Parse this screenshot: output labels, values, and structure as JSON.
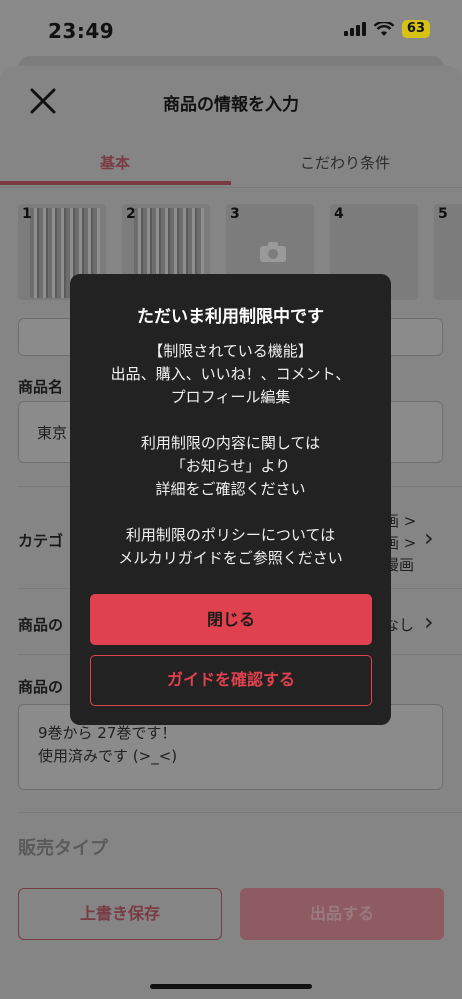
{
  "status_bar": {
    "time": "23:49",
    "battery": "63"
  },
  "header": {
    "title": "商品の情報を入力"
  },
  "tabs": [
    {
      "label": "基本",
      "active": true
    },
    {
      "label": "こだわり条件",
      "active": false
    }
  ],
  "photos": [
    {
      "num": "1",
      "has_image": true
    },
    {
      "num": "2",
      "has_image": true
    },
    {
      "num": "3",
      "has_image": false
    },
    {
      "num": "4",
      "has_image": false
    },
    {
      "num": "5",
      "has_image": false
    }
  ],
  "form": {
    "name_label": "商品名",
    "name_value": "東京",
    "category_label": "カテゴ",
    "category_value_1": "画 >",
    "category_value_2": "画 >",
    "category_value_3": "漫画",
    "condition_label": "商品の",
    "condition_value": "なし",
    "description_label": "商品の",
    "description_line1": "9巻から 27巻です！",
    "description_line2": "使用済みです (>_<)",
    "sale_type_label": "販売タイプ",
    "save_button": "上書き保存",
    "list_button": "出品する"
  },
  "modal": {
    "title": "ただいま利用制限中です",
    "line1": "【制限されている機能】",
    "line2": "出品、購入、いいね！、コメント、",
    "line3": "プロフィール編集",
    "line4": "利用制限の内容に関しては",
    "line5": "「お知らせ」より",
    "line6": "詳細をご確認ください",
    "line7": "利用制限のポリシーについては",
    "line8": "メルカリガイドをご参照ください",
    "close_button": "閉じる",
    "guide_button": "ガイドを確認する"
  },
  "colors": {
    "accent": "#e0414e",
    "modal_bg": "#222222",
    "overlay": "#858585"
  }
}
